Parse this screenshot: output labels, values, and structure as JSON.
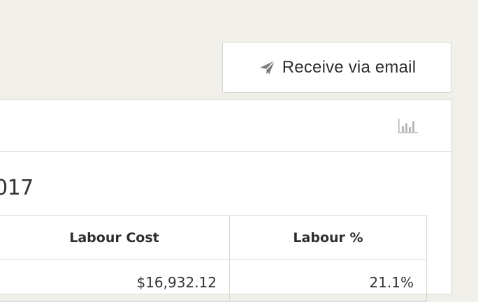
{
  "actions": {
    "email_button_label": "Receive via email",
    "email_icon": "paper-plane-icon"
  },
  "panel": {
    "chart_toggle_icon": "bar-chart-icon",
    "period_title": "017"
  },
  "table": {
    "headers": [
      "Labour Cost",
      "Labour %"
    ],
    "rows": [
      [
        "$16,932.12",
        "21.1%"
      ]
    ]
  },
  "colors": {
    "page_background": "#f1efe9",
    "panel_background": "#ffffff",
    "border": "#dedcd8",
    "icon_gray": "#8a8a8a",
    "chart_icon_gray": "#b7b7b7"
  }
}
